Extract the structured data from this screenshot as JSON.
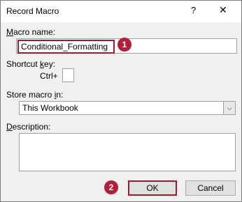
{
  "window": {
    "title": "Record Macro",
    "help_glyph": "?",
    "close_glyph": "✕"
  },
  "macro_name": {
    "label_prefix": "M",
    "label_rest": "acro name:",
    "value": "Conditional_Formatting"
  },
  "shortcut": {
    "label_prefix": "Shortcut ",
    "label_key": "k",
    "label_rest": "ey:",
    "ctrl_label": "Ctrl+",
    "value": ""
  },
  "store": {
    "label_prefix": "Store macro ",
    "label_key": "i",
    "label_rest": "n:",
    "selected": "This Workbook",
    "arrow": "⌵"
  },
  "description": {
    "label_key": "D",
    "label_rest": "escription:",
    "value": ""
  },
  "buttons": {
    "ok": "OK",
    "cancel": "Cancel"
  },
  "badges": {
    "step1": "1",
    "step2": "2"
  },
  "colors": {
    "highlight": "#9b1b30",
    "badge": "#b0203a"
  }
}
